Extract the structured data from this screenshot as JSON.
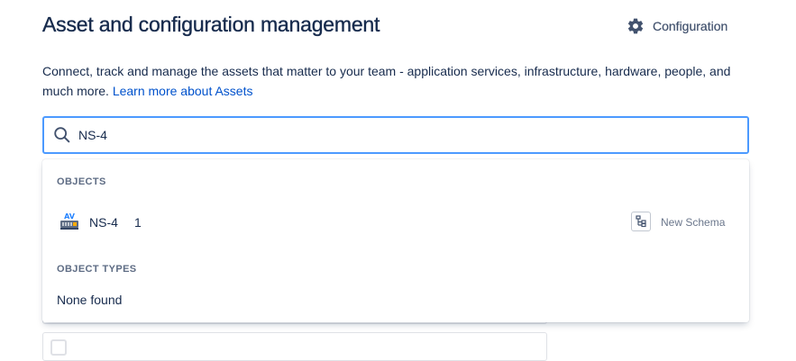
{
  "header": {
    "title": "Asset and configuration management",
    "configuration_label": "Configuration"
  },
  "description": {
    "text": "Connect, track and manage the assets that matter to your team - application services, infrastructure, hardware, people, and much more.",
    "link_text": "Learn more about Assets"
  },
  "search": {
    "value": "NS-4",
    "icon": "search-icon"
  },
  "dropdown": {
    "objects_heading": "OBJECTS",
    "objects": [
      {
        "icon": "av-device-icon",
        "name": "NS-4",
        "id": "1",
        "schema_icon": "schema-tree-icon",
        "schema": "New Schema"
      }
    ],
    "object_types_heading": "OBJECT TYPES",
    "object_types_empty": "None found"
  },
  "colors": {
    "accent": "#0052cc",
    "focus_border": "#4c9aff",
    "text_primary": "#172b4d",
    "text_subtle": "#5e6c84"
  }
}
